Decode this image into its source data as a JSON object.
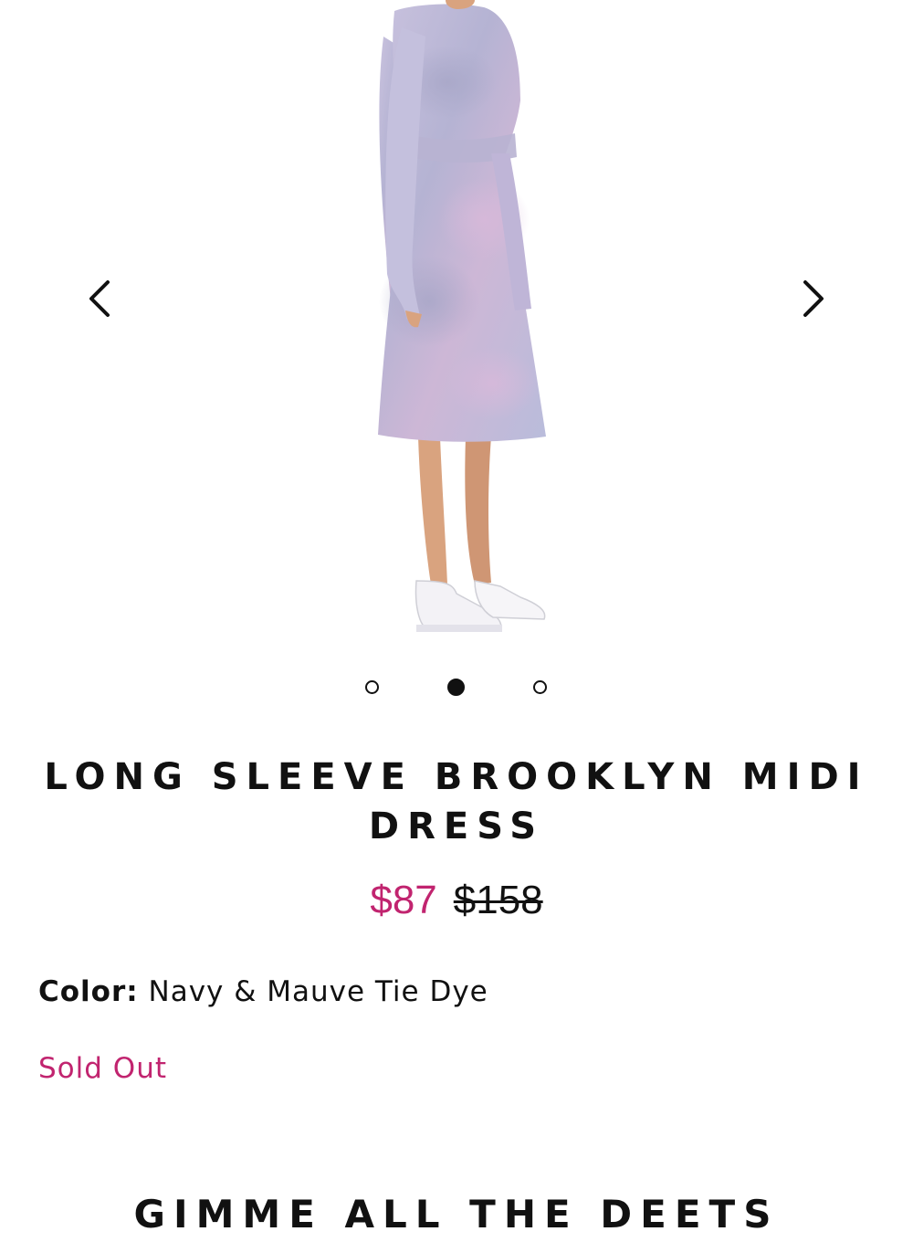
{
  "carousel": {
    "image_alt": "Model wearing long sleeve tie dye midi dress with white sneakers",
    "prev_icon": "chevron-left-icon",
    "next_icon": "chevron-right-icon",
    "slide_count": 3,
    "active_slide": 2
  },
  "product": {
    "title": "LONG SLEEVE BROOKLYN MIDI DRESS",
    "sale_price": "$87",
    "original_price": "$158",
    "color_label": "Color:",
    "color_value": "Navy & Mauve Tie Dye",
    "stock_status": "Sold Out"
  },
  "details": {
    "section_title": "GIMME ALL THE DEETS"
  },
  "colors": {
    "accent": "#c1246f",
    "text": "#111111"
  }
}
